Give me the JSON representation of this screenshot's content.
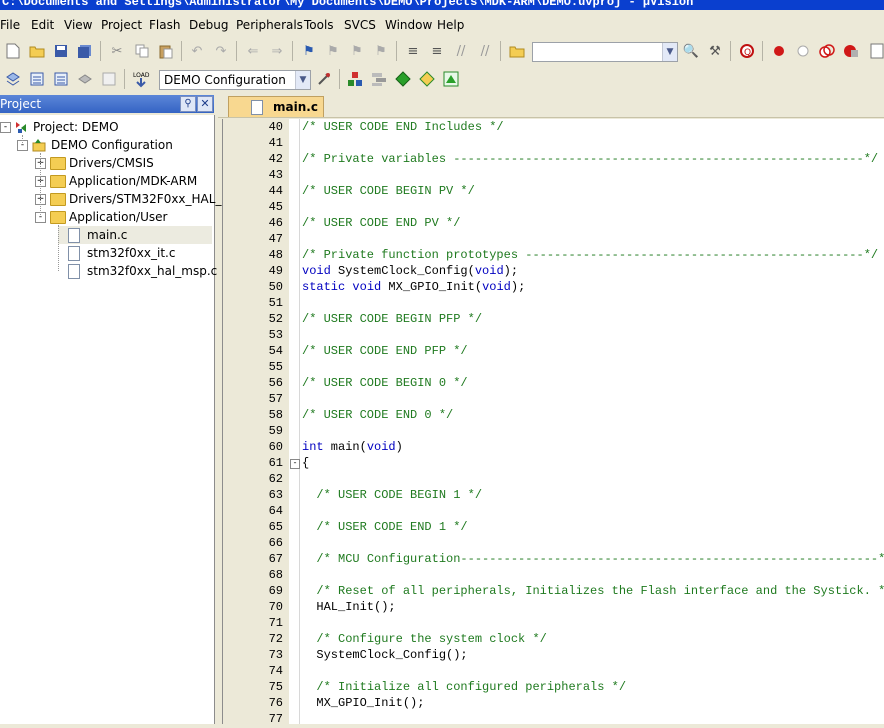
{
  "window": {
    "title": "C:\\Documents and Settings\\Administrator\\My Documents\\DEMO\\Projects\\MDK-ARM\\DEMO.uvproj - µVision"
  },
  "menu": [
    "File",
    "Edit",
    "View",
    "Project",
    "Flash",
    "Debug",
    "Peripherals",
    "Tools",
    "SVCS",
    "Window",
    "Help"
  ],
  "toolbar": {
    "target_select": "DEMO Configuration",
    "find_combo": ""
  },
  "project_panel": {
    "title": "Project",
    "tree": [
      {
        "label": "Project: DEMO",
        "level": 0,
        "toggle": "-",
        "kind": "root"
      },
      {
        "label": "DEMO Configuration",
        "level": 1,
        "toggle": "-",
        "kind": "target"
      },
      {
        "label": "Drivers/CMSIS",
        "level": 2,
        "toggle": "+",
        "kind": "folder"
      },
      {
        "label": "Application/MDK-ARM",
        "level": 2,
        "toggle": "+",
        "kind": "folder"
      },
      {
        "label": "Drivers/STM32F0xx_HAL_[",
        "level": 2,
        "toggle": "+",
        "kind": "folder"
      },
      {
        "label": "Application/User",
        "level": 2,
        "toggle": "-",
        "kind": "folder"
      },
      {
        "label": "main.c",
        "level": 3,
        "toggle": "",
        "kind": "file"
      },
      {
        "label": "stm32f0xx_it.c",
        "level": 3,
        "toggle": "",
        "kind": "file"
      },
      {
        "label": "stm32f0xx_hal_msp.c",
        "level": 3,
        "toggle": "",
        "kind": "file"
      }
    ]
  },
  "editor": {
    "tab": "main.c",
    "lines": [
      {
        "n": "40",
        "parts": [
          [
            "cm",
            "/* USER CODE END Includes */"
          ]
        ]
      },
      {
        "n": "41",
        "parts": []
      },
      {
        "n": "42",
        "parts": [
          [
            "cm",
            "/* Private variables ---------------------------------------------------------*/"
          ]
        ]
      },
      {
        "n": "43",
        "parts": []
      },
      {
        "n": "44",
        "parts": [
          [
            "cm",
            "/* USER CODE BEGIN PV */"
          ]
        ]
      },
      {
        "n": "45",
        "parts": []
      },
      {
        "n": "46",
        "parts": [
          [
            "cm",
            "/* USER CODE END PV */"
          ]
        ]
      },
      {
        "n": "47",
        "parts": []
      },
      {
        "n": "48",
        "parts": [
          [
            "cm",
            "/* Private function prototypes -----------------------------------------------*/"
          ]
        ]
      },
      {
        "n": "49",
        "parts": [
          [
            "kw",
            "void"
          ],
          [
            "tx",
            " SystemClock_Config("
          ],
          [
            "kw",
            "void"
          ],
          [
            "tx",
            ");"
          ]
        ]
      },
      {
        "n": "50",
        "parts": [
          [
            "kw",
            "static"
          ],
          [
            "tx",
            " "
          ],
          [
            "kw",
            "void"
          ],
          [
            "tx",
            " MX_GPIO_Init("
          ],
          [
            "kw",
            "void"
          ],
          [
            "tx",
            ");"
          ]
        ]
      },
      {
        "n": "51",
        "parts": []
      },
      {
        "n": "52",
        "parts": [
          [
            "cm",
            "/* USER CODE BEGIN PFP */"
          ]
        ]
      },
      {
        "n": "53",
        "parts": []
      },
      {
        "n": "54",
        "parts": [
          [
            "cm",
            "/* USER CODE END PFP */"
          ]
        ]
      },
      {
        "n": "55",
        "parts": []
      },
      {
        "n": "56",
        "parts": [
          [
            "cm",
            "/* USER CODE BEGIN 0 */"
          ]
        ]
      },
      {
        "n": "57",
        "parts": []
      },
      {
        "n": "58",
        "parts": [
          [
            "cm",
            "/* USER CODE END 0 */"
          ]
        ]
      },
      {
        "n": "59",
        "parts": []
      },
      {
        "n": "60",
        "parts": [
          [
            "kw",
            "int"
          ],
          [
            "tx",
            " main("
          ],
          [
            "kw",
            "void"
          ],
          [
            "tx",
            ")"
          ]
        ]
      },
      {
        "n": "61",
        "parts": [
          [
            "tx",
            "{"
          ]
        ],
        "fold": "-"
      },
      {
        "n": "62",
        "parts": []
      },
      {
        "n": "63",
        "parts": [
          [
            "tx",
            "  "
          ],
          [
            "cm",
            "/* USER CODE BEGIN 1 */"
          ]
        ]
      },
      {
        "n": "64",
        "parts": []
      },
      {
        "n": "65",
        "parts": [
          [
            "tx",
            "  "
          ],
          [
            "cm",
            "/* USER CODE END 1 */"
          ]
        ]
      },
      {
        "n": "66",
        "parts": []
      },
      {
        "n": "67",
        "parts": [
          [
            "tx",
            "  "
          ],
          [
            "cm",
            "/* MCU Configuration----------------------------------------------------------*/"
          ]
        ]
      },
      {
        "n": "68",
        "parts": []
      },
      {
        "n": "69",
        "parts": [
          [
            "tx",
            "  "
          ],
          [
            "cm",
            "/* Reset of all peripherals, Initializes the Flash interface and the Systick. */"
          ]
        ]
      },
      {
        "n": "70",
        "parts": [
          [
            "tx",
            "  HAL_Init();"
          ]
        ]
      },
      {
        "n": "71",
        "parts": []
      },
      {
        "n": "72",
        "parts": [
          [
            "tx",
            "  "
          ],
          [
            "cm",
            "/* Configure the system clock */"
          ]
        ]
      },
      {
        "n": "73",
        "parts": [
          [
            "tx",
            "  SystemClock_Config();"
          ]
        ]
      },
      {
        "n": "74",
        "parts": []
      },
      {
        "n": "75",
        "parts": [
          [
            "tx",
            "  "
          ],
          [
            "cm",
            "/* Initialize all configured peripherals */"
          ]
        ]
      },
      {
        "n": "76",
        "parts": [
          [
            "tx",
            "  MX_GPIO_Init();"
          ]
        ]
      },
      {
        "n": "77",
        "parts": []
      }
    ]
  }
}
